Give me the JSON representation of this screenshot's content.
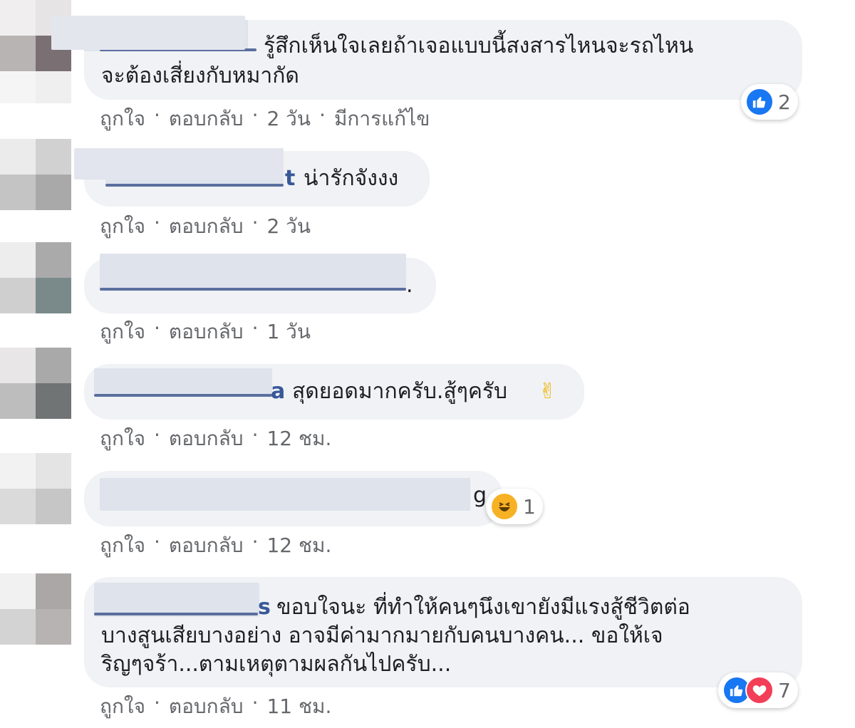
{
  "comments": [
    {
      "text_lines": [
        "รู้สึกเห็นใจเลยถ้าเจอแบบนี้สงสารไหนจะรถไหน",
        "จะต้องเสี่ยงกับหมากัด"
      ],
      "name_fragment": "",
      "actions": {
        "like": "ถูกใจ",
        "reply": "ตอบกลับ",
        "time": "2 วัน",
        "edited": "มีการแก้ไข"
      },
      "reaction": {
        "types": [
          "like-icon"
        ],
        "count": "2"
      }
    },
    {
      "text_lines": [
        "น่ารักจังงง"
      ],
      "name_fragment": "t",
      "actions": {
        "like": "ถูกใจ",
        "reply": "ตอบกลับ",
        "time": "2 วัน"
      }
    },
    {
      "text_lines": [
        "."
      ],
      "name_fragment": "",
      "actions": {
        "like": "ถูกใจ",
        "reply": "ตอบกลับ",
        "time": "1 วัน"
      }
    },
    {
      "text_lines": [
        "สุดยอดมากครับ.สู้ๆครับ"
      ],
      "name_fragment": "a",
      "emoji": "✌",
      "actions": {
        "like": "ถูกใจ",
        "reply": "ตอบกลับ",
        "time": "12 ชม."
      }
    },
    {
      "text_lines": [
        "g"
      ],
      "name_fragment": "",
      "actions": {
        "like": "ถูกใจ",
        "reply": "ตอบกลับ",
        "time": "12 ชม."
      },
      "reaction": {
        "types": [
          "haha-icon"
        ],
        "count": "1"
      }
    },
    {
      "text_lines": [
        "ขอบใจนะ ที่ทำให้คนๆนึงเขายังมีแรงสู้ชีวิตต่อ",
        "บางสูนเสียบางอย่าง อาจมีค่ามากมายกับคนบางคน... ขอให้เจ",
        "ริญๆจร้า...ตามเหตุตามผลกันไปครับ..."
      ],
      "name_fragment": "s",
      "actions": {
        "like": "ถูกใจ",
        "reply": "ตอบกลับ",
        "time": "11 ชม."
      },
      "reaction": {
        "types": [
          "like-icon",
          "love-icon"
        ],
        "count": "7"
      }
    }
  ],
  "separator": "·",
  "colors": {
    "name_link": "#385898",
    "bubble": "#f0f2f5",
    "meta": "#65676b",
    "like": "#1877f2",
    "love": "#f33e58",
    "haha": "#f7b125"
  }
}
